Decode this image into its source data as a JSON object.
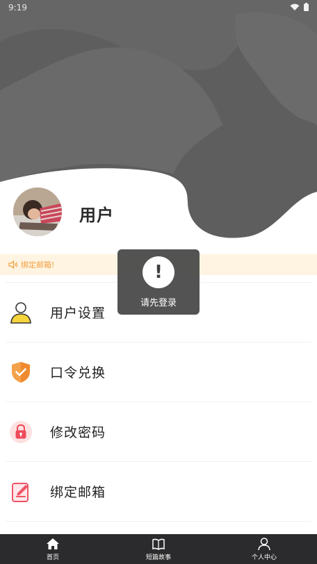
{
  "status_bar": {
    "time": "9:19",
    "icons": [
      "wifi-icon",
      "battery-icon"
    ]
  },
  "profile": {
    "username": "用户"
  },
  "notice": {
    "icon": "speaker-icon",
    "text": "绑定邮箱!"
  },
  "menu": {
    "items": [
      {
        "label": "用户设置",
        "icon": "user-icon"
      },
      {
        "label": "口令兑换",
        "icon": "shield-check-icon"
      },
      {
        "label": "修改密码",
        "icon": "lock-icon"
      },
      {
        "label": "绑定邮箱",
        "icon": "edit-icon"
      }
    ]
  },
  "toast": {
    "icon": "exclamation-icon",
    "text": "请先登录"
  },
  "bottom_nav": {
    "items": [
      {
        "label": "首页",
        "icon": "home-icon"
      },
      {
        "label": "短篇故事",
        "icon": "book-icon"
      },
      {
        "label": "个人中心",
        "icon": "person-icon"
      }
    ]
  },
  "colors": {
    "header_bg": "#5c5c5c",
    "notice_bg": "#fff4e2",
    "notice_text": "#f0a040",
    "nav_bg": "#2b2b2d",
    "toast_bg": "#464646"
  }
}
